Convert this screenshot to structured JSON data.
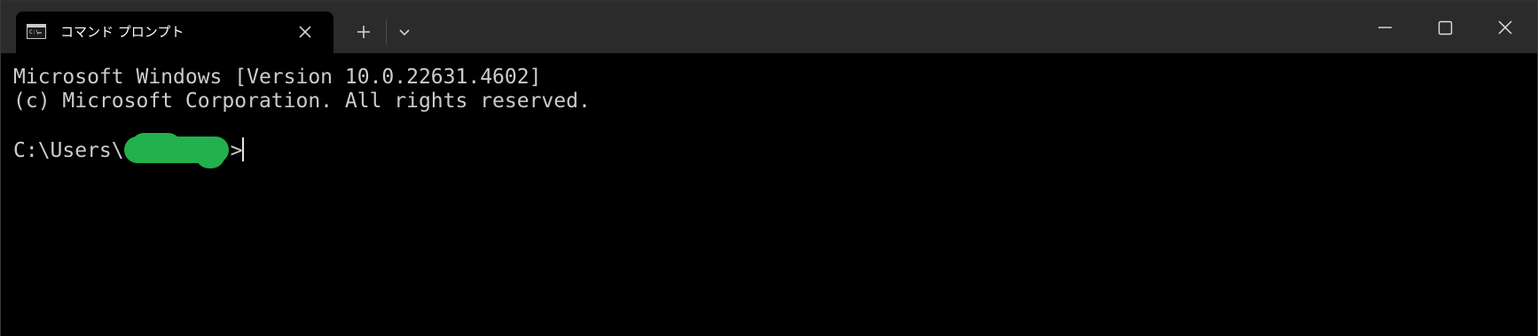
{
  "window": {
    "tab": {
      "title": "コマンド プロンプト",
      "icon": "cmd-terminal-icon",
      "close_icon": "close-icon"
    },
    "new_tab_icon": "plus-icon",
    "dropdown_icon": "chevron-down-icon",
    "controls": {
      "minimize_icon": "minimize-icon",
      "maximize_icon": "maximize-icon",
      "close_icon": "close-icon"
    }
  },
  "terminal": {
    "lines": [
      "Microsoft Windows [Version 10.0.22631.4602]",
      "(c) Microsoft Corporation. All rights reserved."
    ],
    "prompt_prefix": "C:\\Users\\",
    "prompt_suffix": ">"
  },
  "colors": {
    "terminal_background": "#000000",
    "titlebar_background": "#2b2b2b",
    "text": "#cccccc",
    "redaction": "#22b14c"
  }
}
